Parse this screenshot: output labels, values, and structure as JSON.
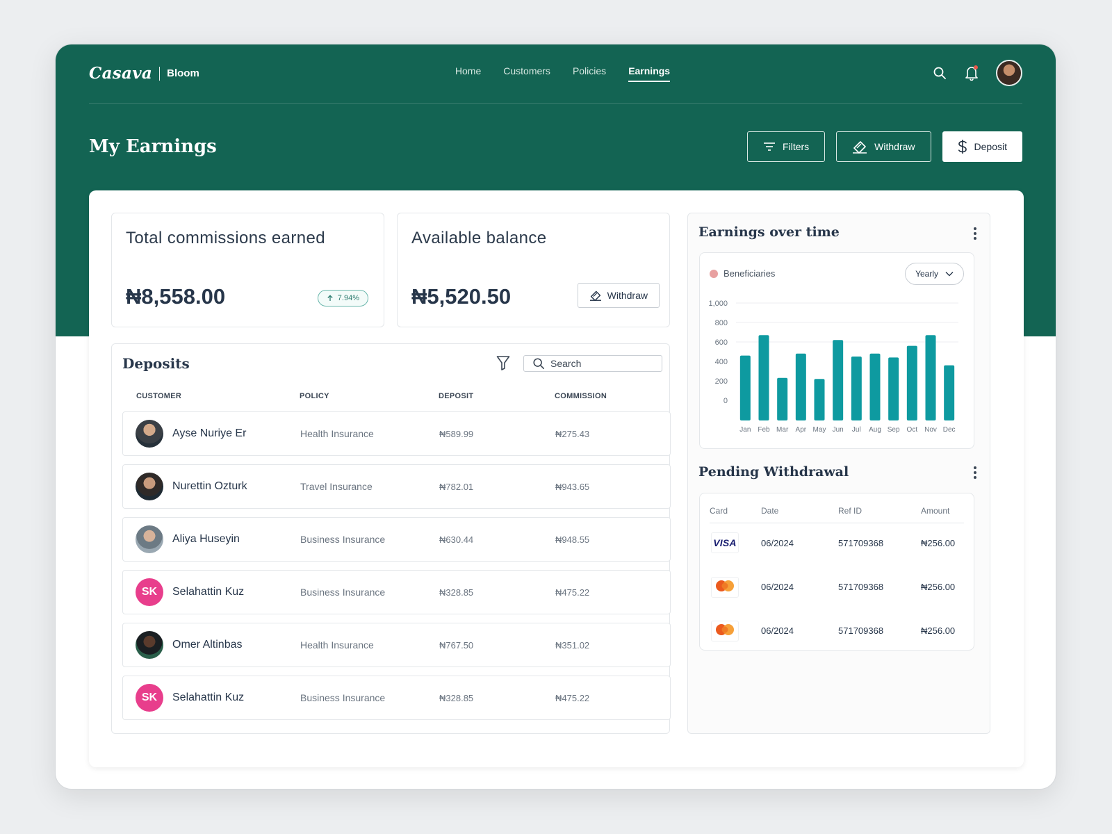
{
  "brand": {
    "logo": "Casava",
    "product": "Bloom"
  },
  "nav": [
    {
      "label": "Home",
      "active": false
    },
    {
      "label": "Customers",
      "active": false
    },
    {
      "label": "Policies",
      "active": false
    },
    {
      "label": "Earnings",
      "active": true
    }
  ],
  "topbar_icons": [
    "search-icon",
    "bell-icon"
  ],
  "page": {
    "title": "My Earnings",
    "actions": {
      "filters": "Filters",
      "withdraw": "Withdraw",
      "deposit": "Deposit"
    }
  },
  "stats": {
    "total": {
      "title": "Total commissions earned",
      "amount": "₦8,558.00",
      "trend": "7.94%"
    },
    "balance": {
      "title": "Available balance",
      "amount": "₦5,520.50",
      "withdraw_label": "Withdraw"
    }
  },
  "deposits": {
    "title": "Deposits",
    "search_placeholder": "Search",
    "columns": [
      "CUSTOMER",
      "POLICY",
      "DEPOSIT",
      "COMMISSION"
    ],
    "rows": [
      {
        "avatar": "photo",
        "initials": "",
        "name": "Ayse Nuriye Er",
        "policy": "Health Insurance",
        "deposit": "₦589.99",
        "commission": "₦275.43"
      },
      {
        "avatar": "photo",
        "initials": "",
        "name": "Nurettin Ozturk",
        "policy": "Travel Insurance",
        "deposit": "₦782.01",
        "commission": "₦943.65"
      },
      {
        "avatar": "photo",
        "initials": "",
        "name": "Aliya Huseyin",
        "policy": "Business Insurance",
        "deposit": "₦630.44",
        "commission": "₦948.55"
      },
      {
        "avatar": "initials",
        "initials": "SK",
        "name": "Selahattin Kuz",
        "policy": "Business Insurance",
        "deposit": "₦328.85",
        "commission": "₦475.22"
      },
      {
        "avatar": "photo",
        "initials": "",
        "name": "Omer Altinbas",
        "policy": "Health Insurance",
        "deposit": "₦767.50",
        "commission": "₦351.02"
      },
      {
        "avatar": "initials",
        "initials": "SK",
        "name": "Selahattin Kuz",
        "policy": "Business Insurance",
        "deposit": "₦328.85",
        "commission": "₦475.22"
      }
    ]
  },
  "earnings_chart": {
    "title": "Earnings over time",
    "legend": "Beneficiaries",
    "period": "Yearly"
  },
  "chart_data": {
    "type": "bar",
    "title": "Earnings over time",
    "categories": [
      "Jan",
      "Feb",
      "Mar",
      "Apr",
      "May",
      "Jun",
      "Jul",
      "Aug",
      "Sep",
      "Oct",
      "Nov",
      "Dec"
    ],
    "series": [
      {
        "name": "Beneficiaries",
        "values": [
          460,
          670,
          230,
          480,
          220,
          620,
          450,
          480,
          440,
          560,
          670,
          360
        ]
      }
    ],
    "yticks": [
      "0",
      "200",
      "400",
      "600",
      "800",
      "1,000"
    ],
    "ylim": [
      -100,
      1000
    ],
    "grid": true,
    "legend_position": "top-left"
  },
  "pending": {
    "title": "Pending Withdrawal",
    "columns": [
      "Card",
      "Date",
      "Ref ID",
      "Amount"
    ],
    "rows": [
      {
        "card": "VISA",
        "date": "06/2024",
        "ref": "571709368",
        "amount": "₦256.00"
      },
      {
        "card": "mastercard",
        "date": "06/2024",
        "ref": "571709368",
        "amount": "₦256.00"
      },
      {
        "card": "mastercard",
        "date": "06/2024",
        "ref": "571709368",
        "amount": "₦256.00"
      }
    ]
  },
  "colors": {
    "brand_green": "#136453",
    "bar_teal": "#0e9aa0",
    "legend_dot": "#e8a0a0",
    "initials_pink": "#e83e8c",
    "trend_green": "#2e7c70"
  }
}
